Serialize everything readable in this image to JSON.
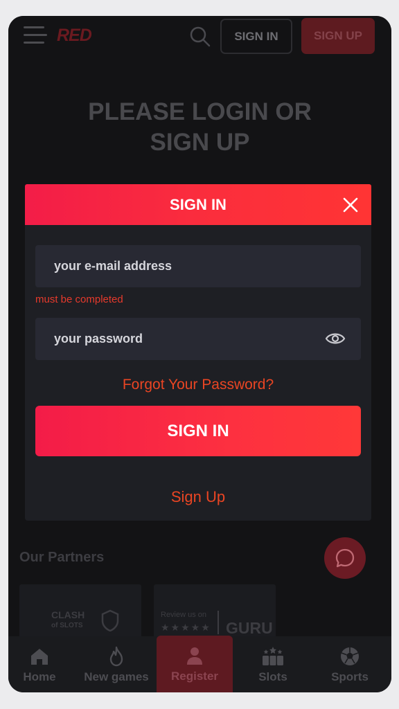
{
  "header": {
    "logo": "RED",
    "signin_label": "SIGN IN",
    "signup_label": "SIGN UP"
  },
  "page_title": "PLEASE LOGIN OR SIGN UP",
  "modal": {
    "title": "SIGN IN",
    "email_placeholder": "your e-mail address",
    "email_error": "must be completed",
    "password_placeholder": "your password",
    "forgot_label": "Forgot Your Password?",
    "submit_label": "SIGN IN",
    "signup_label": "Sign Up"
  },
  "partners": {
    "title": "Our Partners",
    "items": [
      {
        "line1": "CLASH",
        "line2": "of SLOTS"
      },
      {
        "review": "Review us on",
        "stars": "★★★★★",
        "brand": "GURU"
      }
    ]
  },
  "bottom_nav": {
    "items": [
      {
        "label": "Home",
        "icon": "home-icon"
      },
      {
        "label": "New games",
        "icon": "flame-icon"
      },
      {
        "label": "Register",
        "icon": "user-icon"
      },
      {
        "label": "Slots",
        "icon": "slots-icon"
      },
      {
        "label": "Sports",
        "icon": "soccer-ball-icon"
      }
    ]
  },
  "colors": {
    "accent": "#fb2e3c",
    "link": "#ea4523",
    "background": "#131315",
    "input": "#282933"
  }
}
